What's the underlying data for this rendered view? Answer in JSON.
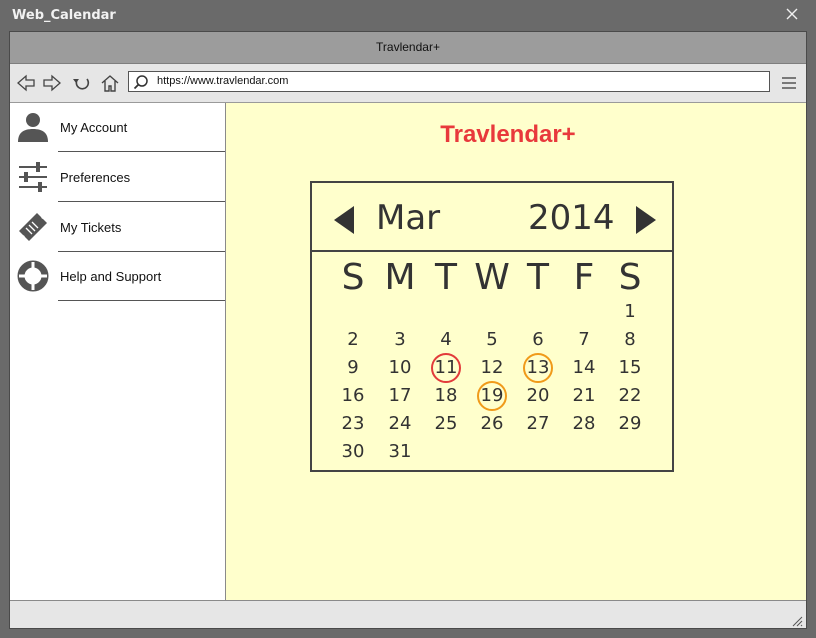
{
  "window": {
    "title": "Web_Calendar"
  },
  "browser": {
    "tab_title": "Travlendar+",
    "url": "https://www.travlendar.com"
  },
  "sidebar": {
    "items": [
      {
        "label": "My Account",
        "icon": "user-icon"
      },
      {
        "label": "Preferences",
        "icon": "sliders-icon"
      },
      {
        "label": "My Tickets",
        "icon": "ticket-icon"
      },
      {
        "label": "Help and Support",
        "icon": "lifebuoy-icon"
      }
    ]
  },
  "main": {
    "brand": "Travlendar+"
  },
  "calendar": {
    "month": "Mar",
    "year": "2014",
    "weekdays": [
      "S",
      "M",
      "T",
      "W",
      "T",
      "F",
      "S"
    ],
    "first_weekday_index": 6,
    "days_in_month": 31,
    "today": 11,
    "event_days": [
      13,
      19
    ],
    "today_color": "#e23b3b",
    "event_color": "#f09a1a"
  },
  "colors": {
    "brand": "#e8393c",
    "main_background": "#ffffcc"
  }
}
